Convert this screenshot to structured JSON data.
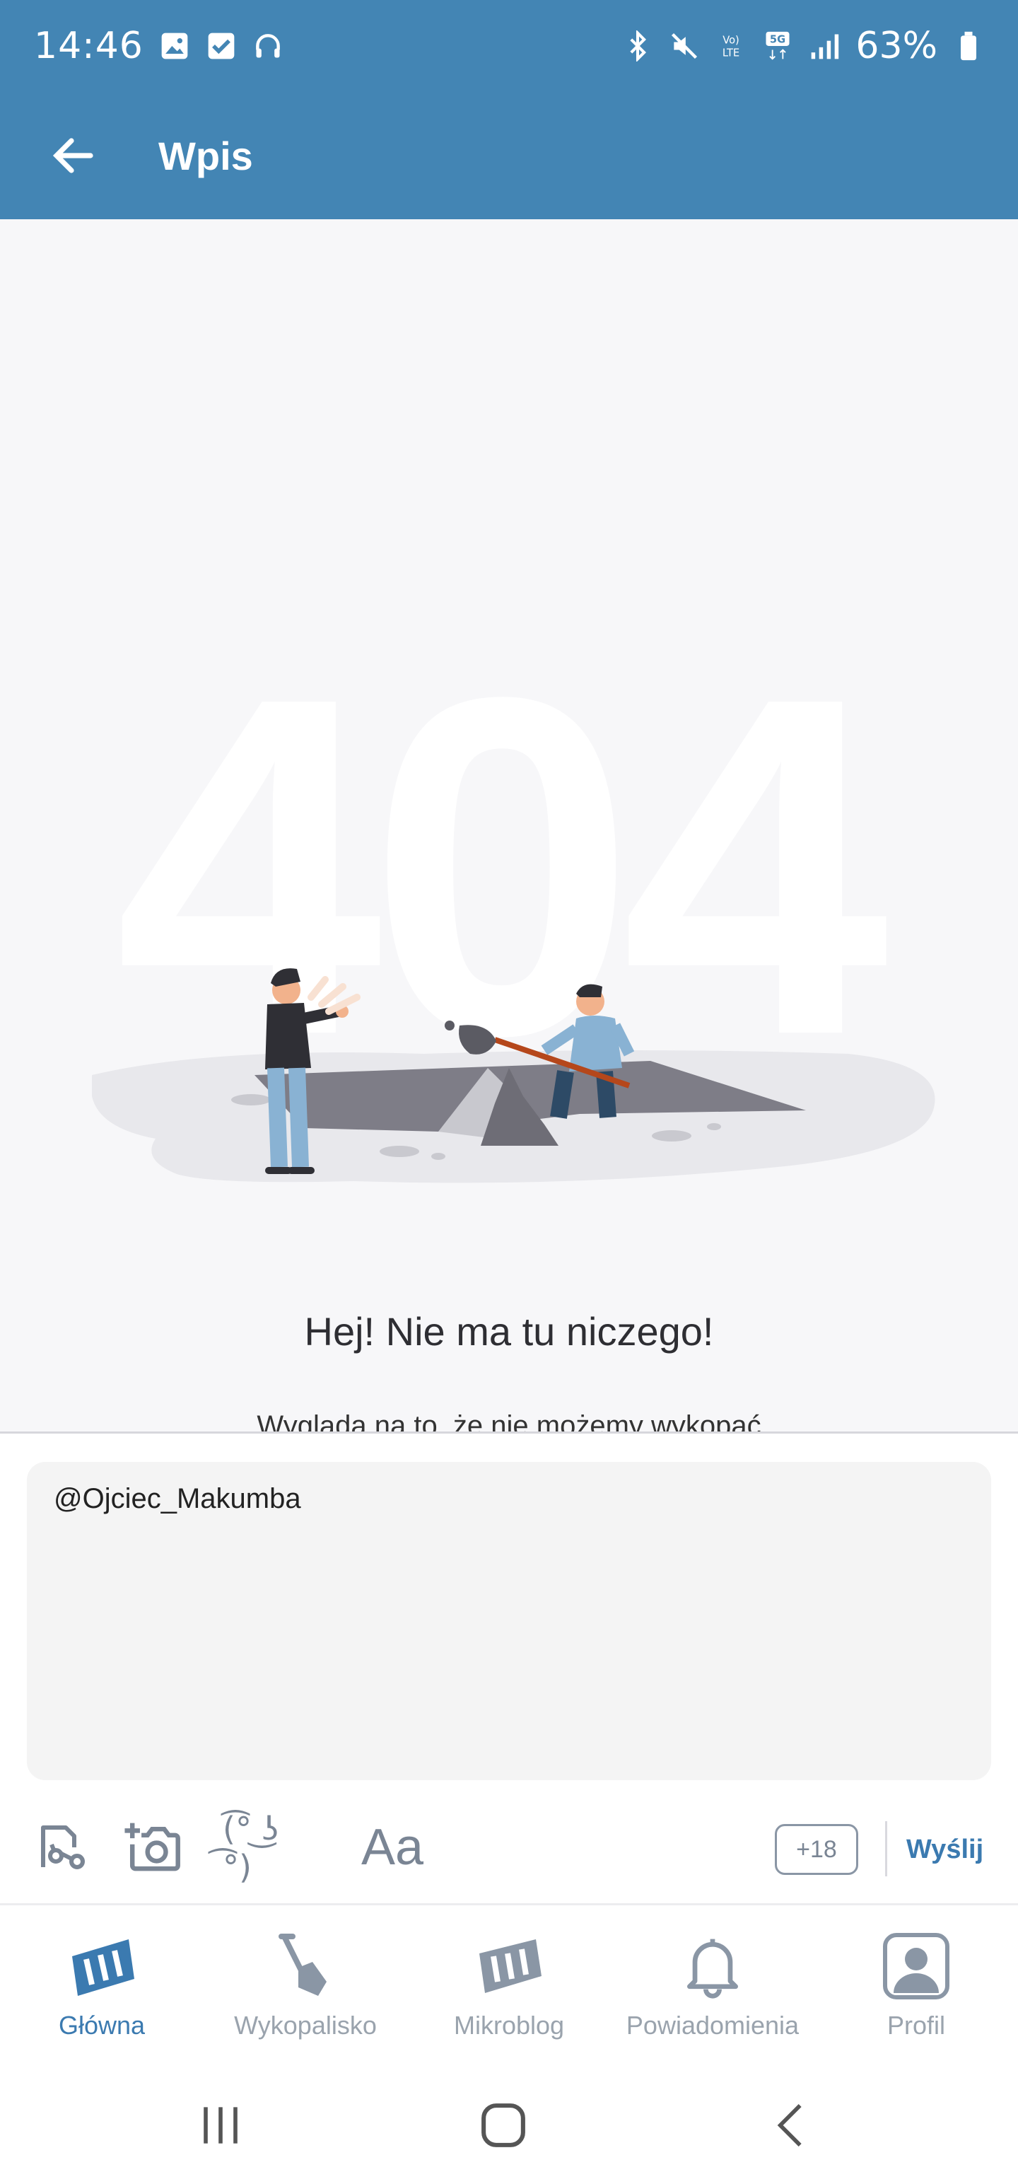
{
  "status_bar": {
    "time": "14:46",
    "battery_percent": "63%",
    "network_badge_top": "Vo)",
    "network_badge_bottom": "LTE",
    "network_5g": "5G"
  },
  "app_bar": {
    "title": "Wpis"
  },
  "error_page": {
    "big_code": "404",
    "title": "Hej! Nie ma tu niczego!",
    "subtitle": "Wygląda na to, że nie możemy wykopać"
  },
  "composer": {
    "text_value": "@Ojciec_Makumba",
    "lenny_face": "(͡° ͜ʖ ͡°)",
    "font_button": "Aa",
    "char_counter": "+18",
    "send_label": "Wyślij"
  },
  "bottom_nav": {
    "items": [
      {
        "label": "Główna",
        "icon": "home-icon",
        "active": true
      },
      {
        "label": "Wykopalisko",
        "icon": "shovel-icon",
        "active": false
      },
      {
        "label": "Mikroblog",
        "icon": "microblog-icon",
        "active": false
      },
      {
        "label": "Powiadomienia",
        "icon": "bell-icon",
        "active": false
      },
      {
        "label": "Profil",
        "icon": "profile-icon",
        "active": false
      }
    ]
  },
  "colors": {
    "primary": "#4385b4",
    "accent": "#3b7ab0",
    "muted": "#9aa3ad"
  }
}
